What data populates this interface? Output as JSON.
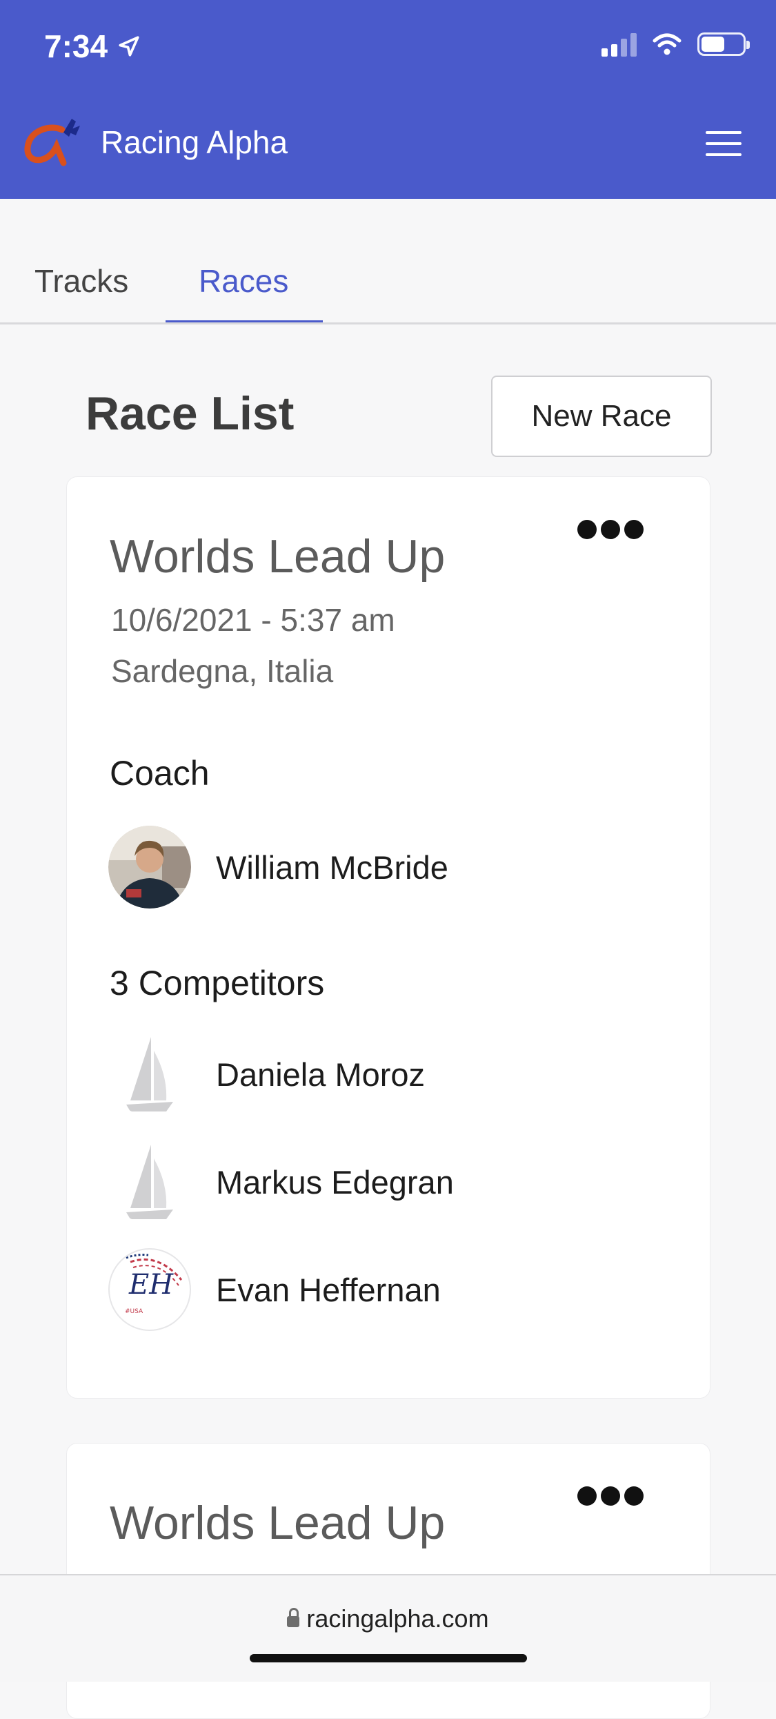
{
  "status_bar": {
    "time": "7:34"
  },
  "app": {
    "title": "Racing Alpha"
  },
  "tabs": [
    {
      "label": "Tracks",
      "active": false
    },
    {
      "label": "Races",
      "active": true
    }
  ],
  "race_list": {
    "title": "Race List",
    "new_race_label": "New Race"
  },
  "races": [
    {
      "name": "Worlds Lead Up",
      "date": "10/6/2021 - 5:37 am",
      "location": "Sardegna, Italia",
      "coach_label": "Coach",
      "coach": {
        "name": "William McBride",
        "avatar": "photo"
      },
      "competitors_label": "3 Competitors",
      "competitors": [
        {
          "name": "Daniela Moroz",
          "avatar": "sailboat-icon"
        },
        {
          "name": "Markus Edegran",
          "avatar": "sailboat-icon"
        },
        {
          "name": "Evan Heffernan",
          "avatar": "eh-logo",
          "logo_text": "EH"
        }
      ]
    },
    {
      "name": "Worlds Lead Up"
    }
  ],
  "browser": {
    "url": "racingalpha.com"
  },
  "colors": {
    "brand": "#4a5acb",
    "logo_alpha": "#d9501d"
  }
}
